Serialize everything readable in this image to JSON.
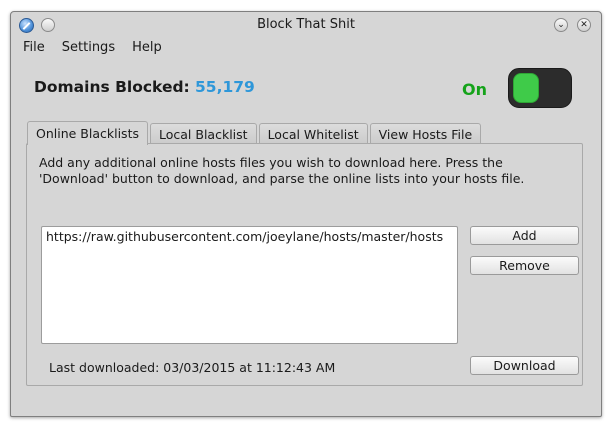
{
  "window": {
    "title": "Block That Shit"
  },
  "titlebar": {
    "minimize_glyph": "⌄",
    "close_glyph": "✕"
  },
  "menu": [
    "File",
    "Settings",
    "Help"
  ],
  "stats": {
    "domains_blocked_label": "Domains Blocked:",
    "domains_blocked_count": "55,179"
  },
  "toggle": {
    "state_label": "On",
    "state": true
  },
  "tabs": [
    {
      "label": "Online Blacklists",
      "active": true
    },
    {
      "label": "Local Blacklist",
      "active": false
    },
    {
      "label": "Local Whitelist",
      "active": false
    },
    {
      "label": "View Hosts File",
      "active": false
    }
  ],
  "online_blacklists": {
    "description": "Add any additional online hosts files you wish to download here. Press the 'Download' button to download, and parse the online lists into your hosts file.",
    "urls": [
      "https://raw.githubusercontent.com/joeylane/hosts/master/hosts"
    ],
    "add_label": "Add",
    "remove_label": "Remove",
    "download_label": "Download",
    "last_downloaded": "Last downloaded: 03/03/2015 at 11:12:43 AM"
  },
  "colors": {
    "count": "#2e97d9",
    "on_text": "#15a31a",
    "toggle_on": "#3fcb49",
    "toggle_bg": "#2c2c2c",
    "window_bg": "#d6d6d6"
  }
}
